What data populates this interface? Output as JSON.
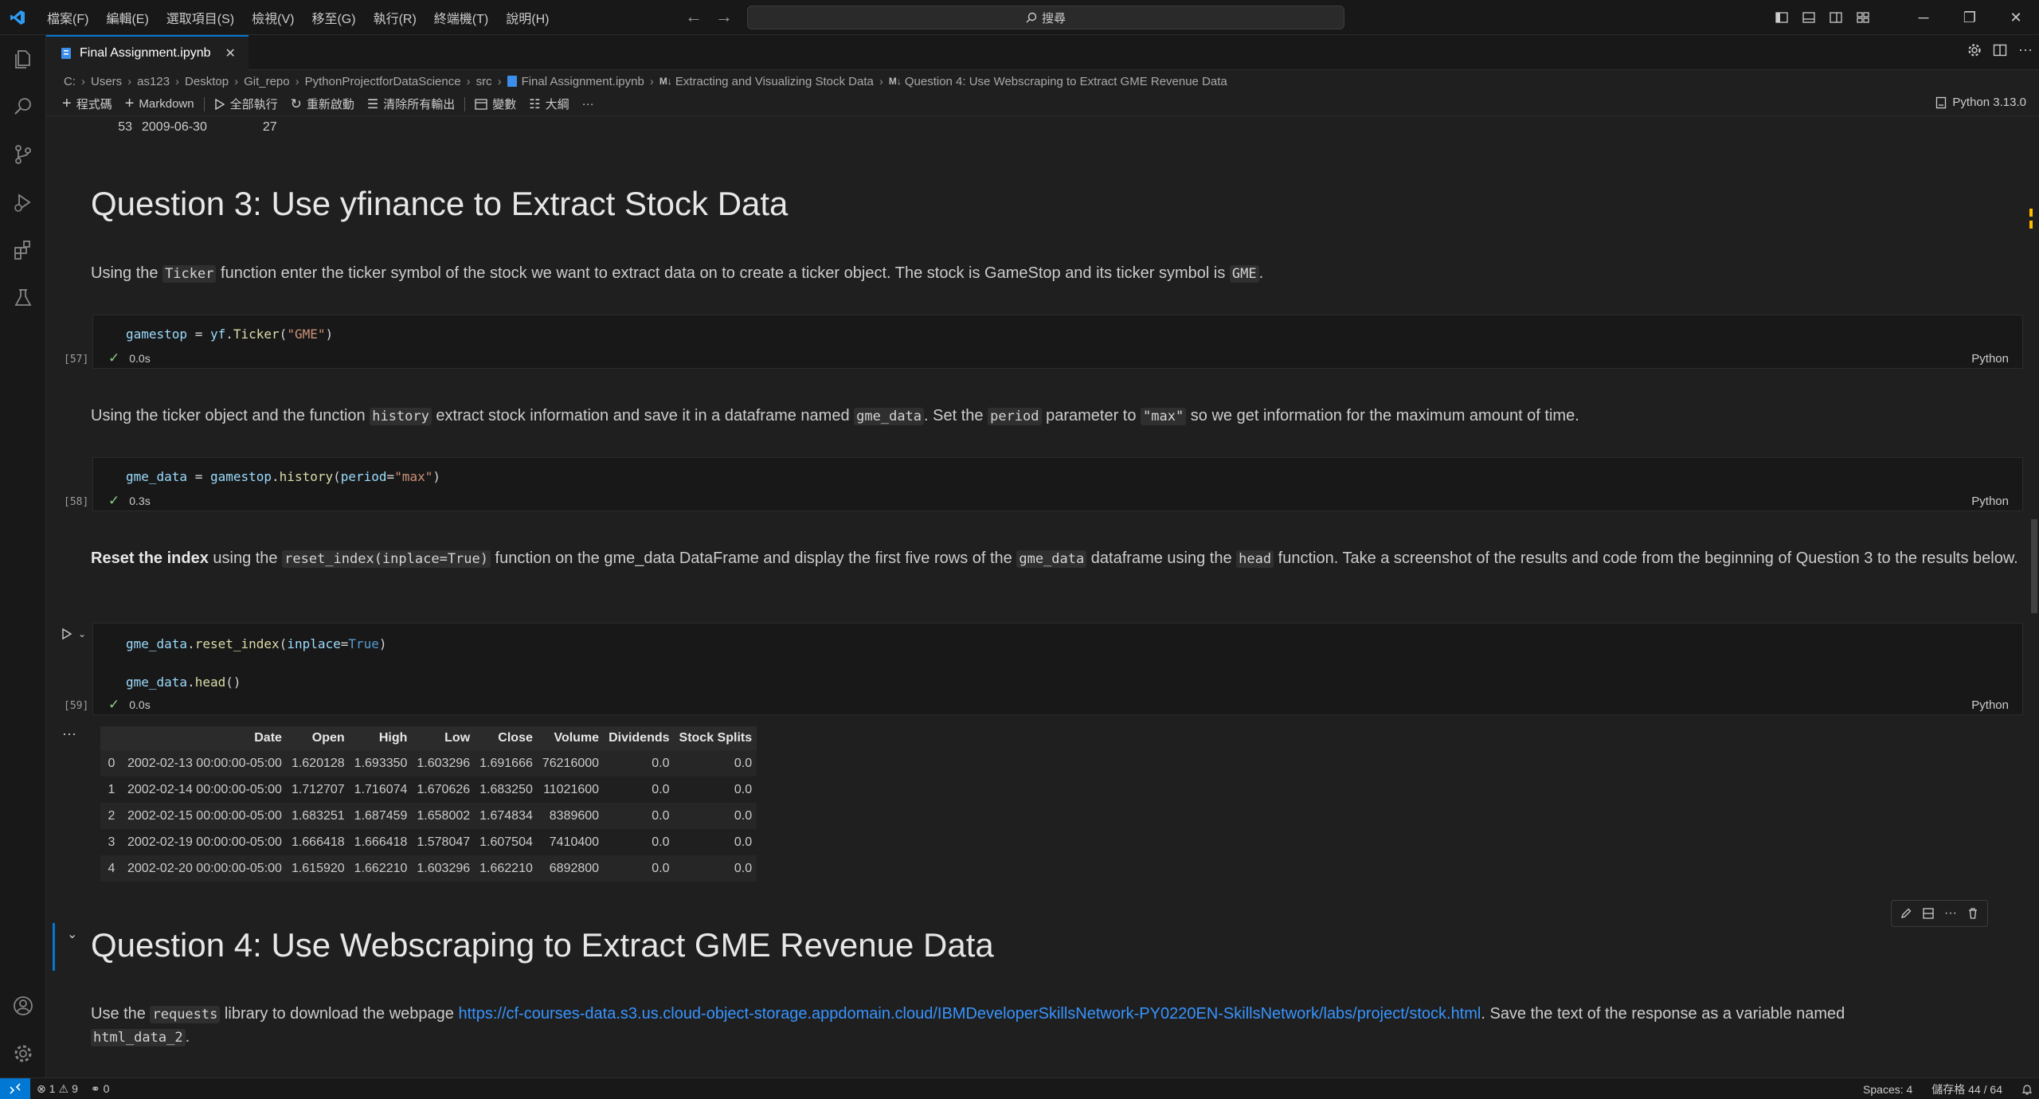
{
  "menu": [
    "檔案(F)",
    "編輯(E)",
    "選取項目(S)",
    "檢視(V)",
    "移至(G)",
    "執行(R)",
    "終端機(T)",
    "說明(H)"
  ],
  "search": {
    "placeholder": "搜尋"
  },
  "tab": {
    "label": "Final Assignment.ipynb",
    "close": "✕"
  },
  "breadcrumb": {
    "path": [
      "C:",
      "Users",
      "as123",
      "Desktop",
      "Git_repo",
      "PythonProjectforDataScience",
      "src"
    ],
    "file": "Final Assignment.ipynb",
    "md_tag": "M↓",
    "section": "Extracting and Visualizing Stock Data",
    "subsection": "Question 4: Use Webscraping to Extract GME Revenue Data"
  },
  "toolbar": {
    "code": "程式碼",
    "markdown": "Markdown",
    "run_all": "全部執行",
    "restart": "重新啟動",
    "clear_outputs": "清除所有輸出",
    "variables": "變數",
    "outline": "大綱",
    "more": "···",
    "kernel": "Python 3.13.0"
  },
  "prev_row": {
    "index": "53",
    "date": "2009-06-30",
    "value": "27"
  },
  "q3": {
    "title": "Question 3: Use yfinance to Extract Stock Data",
    "p1": {
      "a": "Using the ",
      "code1": "Ticker",
      "b": " function enter the ticker symbol of the stock we want to extract data on to create a ticker object. The stock is GameStop and its ticker symbol is ",
      "code2": "GME",
      "c": "."
    },
    "p2": {
      "a": "Using the ticker object and the function ",
      "code1": "history",
      "b": " extract stock information and save it in a dataframe named ",
      "code2": "gme_data",
      "c": ". Set the ",
      "code3": "period",
      "d": " parameter to ",
      "code4": "\"max\"",
      "e": " so we get information for the maximum amount of time."
    },
    "p3": {
      "bold": "Reset the index",
      "a": " using the ",
      "code1": "reset_index(inplace=True)",
      "b": " function on the gme_data DataFrame and display the first five rows of the ",
      "code2": "gme_data",
      "c": " dataframe using the ",
      "code3": "head",
      "d": " function. Take a screenshot of the results and code from the beginning of Question 3 to the results below."
    }
  },
  "cells": [
    {
      "exec": "[57]",
      "time": "0.0s",
      "lang": "Python",
      "code": {
        "v1": "gamestop",
        "eq": " = ",
        "v2": "yf",
        "dot": ".",
        "fn": "Ticker",
        "o": "(",
        "s": "\"GME\"",
        "c": ")"
      }
    },
    {
      "exec": "[58]",
      "time": "0.3s",
      "lang": "Python",
      "code": {
        "v1": "gme_data",
        "eq": " = ",
        "v2": "gamestop",
        "dot": ".",
        "fn": "history",
        "o": "(",
        "p": "period",
        "peq": "=",
        "s": "\"max\"",
        "c": ")"
      }
    },
    {
      "exec": "[59]",
      "time": "0.0s",
      "lang": "Python",
      "code": {
        "v1": "gme_data",
        "dot": ".",
        "fn": "reset_index",
        "o": "(",
        "p": "inplace",
        "peq": "=",
        "kw": "True",
        "c": ")",
        "v2": "gme_data",
        "dot2": ".",
        "fn2": "head",
        "o2": "()"
      }
    }
  ],
  "output": {
    "ellipsis": "···",
    "columns": [
      "",
      "Date",
      "Open",
      "High",
      "Low",
      "Close",
      "Volume",
      "Dividends",
      "Stock Splits"
    ],
    "rows": [
      [
        "0",
        "2002-02-13 00:00:00-05:00",
        "1.620128",
        "1.693350",
        "1.603296",
        "1.691666",
        "76216000",
        "0.0",
        "0.0"
      ],
      [
        "1",
        "2002-02-14 00:00:00-05:00",
        "1.712707",
        "1.716074",
        "1.670626",
        "1.683250",
        "11021600",
        "0.0",
        "0.0"
      ],
      [
        "2",
        "2002-02-15 00:00:00-05:00",
        "1.683251",
        "1.687459",
        "1.658002",
        "1.674834",
        "8389600",
        "0.0",
        "0.0"
      ],
      [
        "3",
        "2002-02-19 00:00:00-05:00",
        "1.666418",
        "1.666418",
        "1.578047",
        "1.607504",
        "7410400",
        "0.0",
        "0.0"
      ],
      [
        "4",
        "2002-02-20 00:00:00-05:00",
        "1.615920",
        "1.662210",
        "1.603296",
        "1.662210",
        "6892800",
        "0.0",
        "0.0"
      ]
    ]
  },
  "q4": {
    "title": "Question 4: Use Webscraping to Extract GME Revenue Data",
    "p1": {
      "a": "Use the ",
      "code1": "requests",
      "b": " library to download the webpage ",
      "link": "https://cf-courses-data.s3.us.cloud-object-storage.appdomain.cloud/IBMDeveloperSkillsNetwork-PY0220EN-SkillsNetwork/labs/project/stock.html",
      "c": ". Save the text of the response as a variable named",
      "code2": "html_data_2",
      "d": "."
    }
  },
  "status": {
    "errors": "1",
    "warnings": "9",
    "ports": "0",
    "spaces": "Spaces: 4",
    "cells": "儲存格 44 / 64"
  },
  "colors": {
    "accent": "#0078d4",
    "success": "#89d185",
    "link": "#3794ff"
  }
}
